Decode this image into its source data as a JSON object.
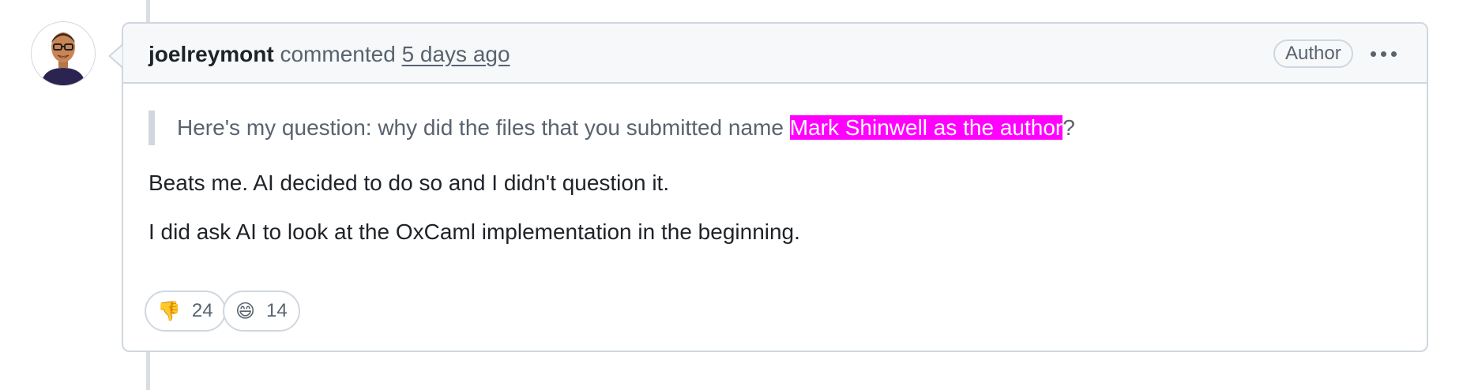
{
  "comment": {
    "author": "joelreymont",
    "action": "commented",
    "timestamp": "5 days ago",
    "badge": "Author",
    "quote": {
      "text_before": "Here's my question: why did the files that you submitted name ",
      "highlighted": "Mark Shinwell as the author",
      "text_after": "?"
    },
    "paragraphs": [
      "Beats me. AI decided to do so and I didn't question it.",
      "I did ask AI to look at the OxCaml implementation in the beginning."
    ],
    "reactions": [
      {
        "icon": "thumbs-down-icon",
        "emoji": "👎",
        "count": "24"
      },
      {
        "icon": "grinning-face-icon",
        "emoji": "😄",
        "count": "14"
      }
    ]
  },
  "colors": {
    "highlight": "#ff00ff",
    "border": "#d0d7de",
    "header_bg": "#f6f8fa",
    "muted_text": "#59636e",
    "text": "#1f2328"
  }
}
